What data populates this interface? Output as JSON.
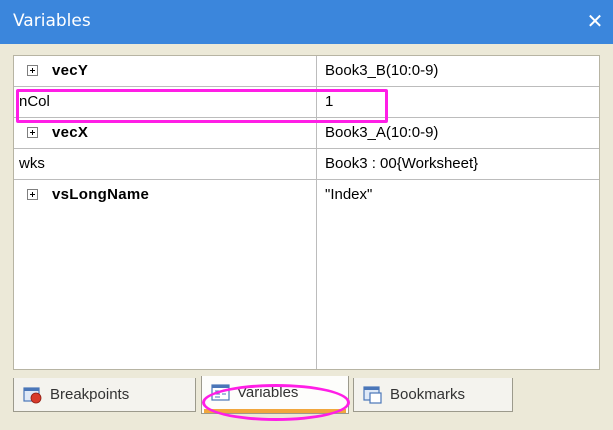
{
  "window": {
    "title": "Variables",
    "close_glyph": "✕"
  },
  "variables": [
    {
      "name": "vecY",
      "value": "Book3_B(10:0-9)",
      "expandable": true,
      "bold": true
    },
    {
      "name": "nCol",
      "value": "1",
      "expandable": false,
      "bold": false
    },
    {
      "name": "vecX",
      "value": "Book3_A(10:0-9)",
      "expandable": true,
      "bold": true
    },
    {
      "name": "wks",
      "value": "Book3 : 00{Worksheet}",
      "expandable": false,
      "bold": false
    },
    {
      "name": "vsLongName",
      "value": "\"Index\"",
      "expandable": true,
      "bold": true
    }
  ],
  "tabs": [
    {
      "label": "Breakpoints",
      "icon": "breakpoints-icon",
      "active": false
    },
    {
      "label": "Variables",
      "icon": "variables-icon",
      "active": true
    },
    {
      "label": "Bookmarks",
      "icon": "bookmarks-icon",
      "active": false
    }
  ],
  "colors": {
    "titlebar": "#3b86dc",
    "highlight": "#ff1ee6",
    "active_tab_underline": "#f1a73d"
  }
}
